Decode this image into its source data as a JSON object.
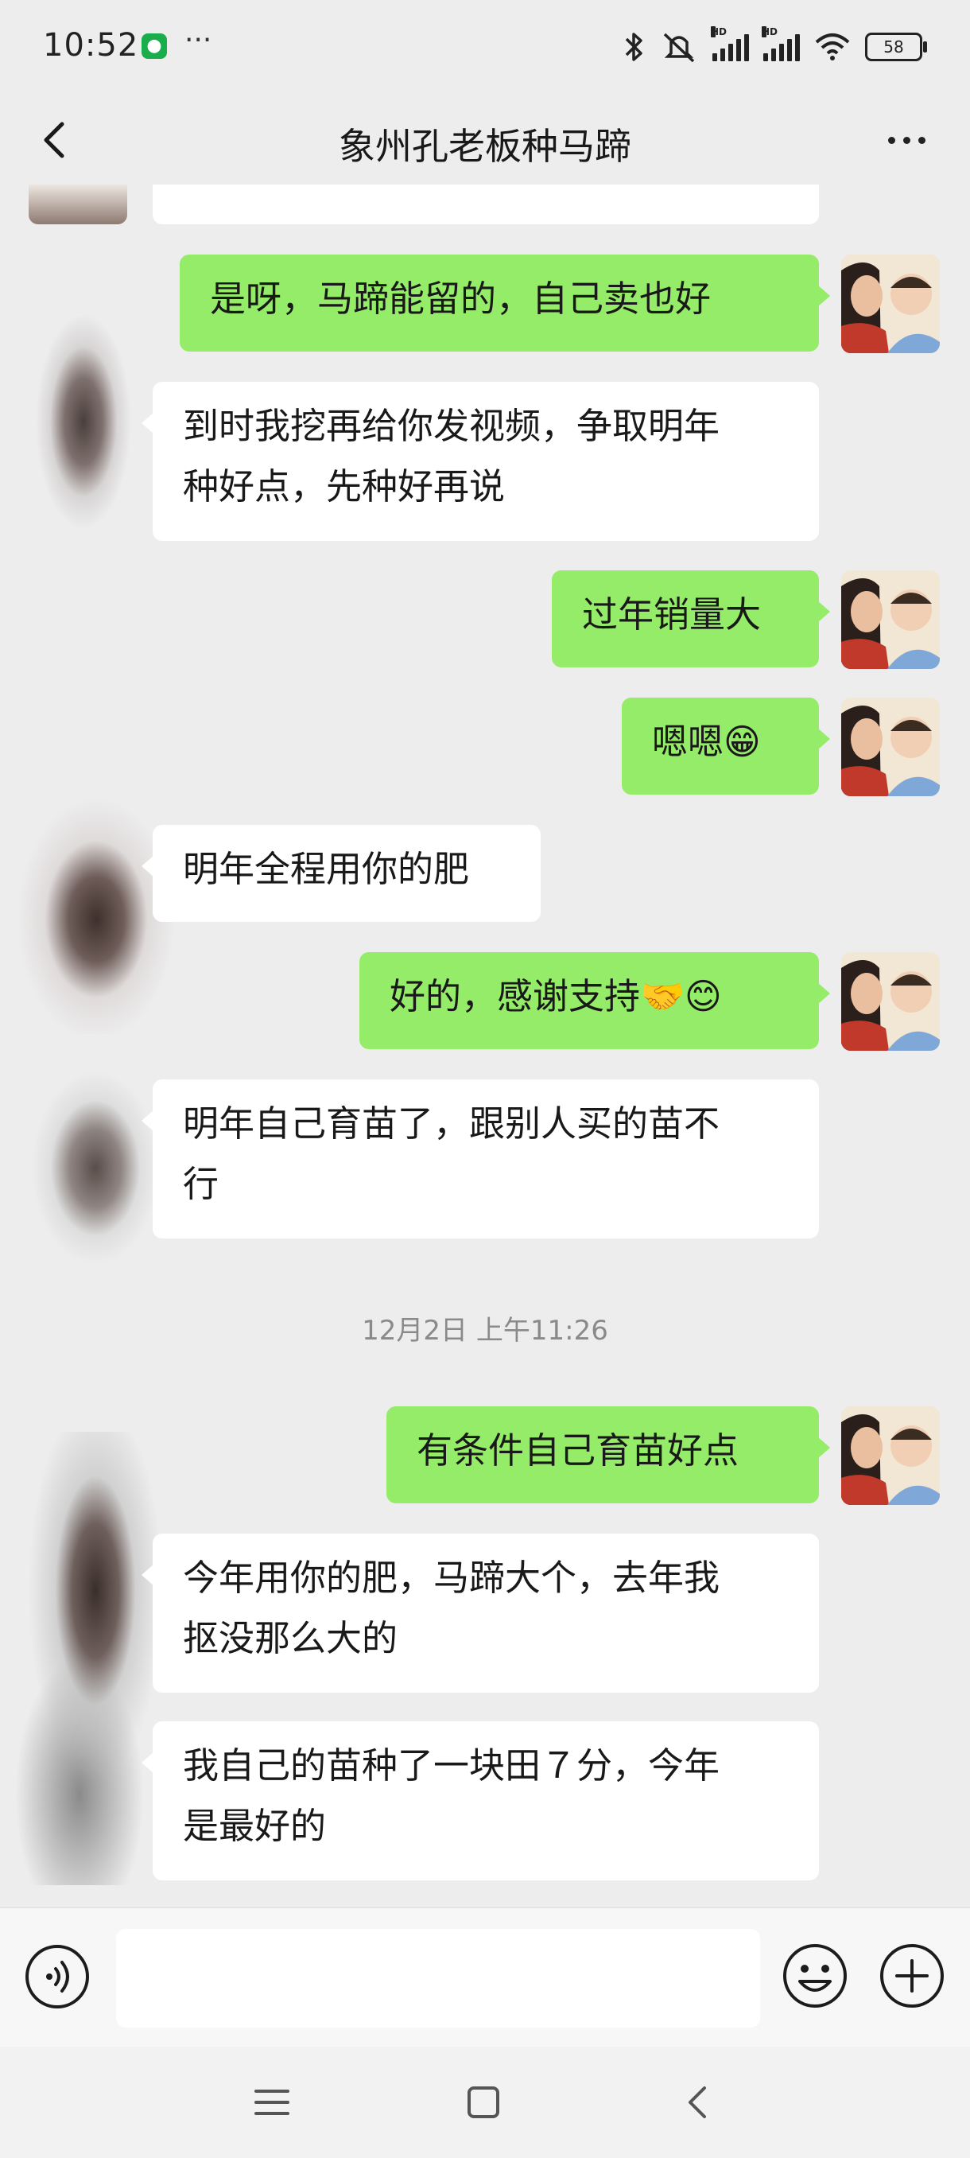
{
  "status_bar": {
    "time": "10:52",
    "more": "···",
    "battery": "58",
    "icons": [
      "bluetooth-icon",
      "mute-icon",
      "signal-hd-icon",
      "signal-hd-icon",
      "wifi-icon",
      "battery-icon"
    ]
  },
  "header": {
    "title": "象州孔老板种马蹄"
  },
  "messages": [
    {
      "from": "me",
      "text": "是呀，马蹄能留的，自己卖也好"
    },
    {
      "from": "other",
      "lines": [
        "到时我挖再给你发视频，争取明年",
        "种好点，先种好再说"
      ]
    },
    {
      "from": "me",
      "text": "过年销量大"
    },
    {
      "from": "me",
      "text": "嗯嗯😁"
    },
    {
      "from": "other",
      "text": "明年全程用你的肥"
    },
    {
      "from": "me",
      "text": "好的，感谢支持🤝😊"
    },
    {
      "from": "other",
      "lines": [
        "明年自己育苗了，跟别人买的苗不",
        "行"
      ]
    },
    {
      "from": "me",
      "text": "有条件自己育苗好点"
    },
    {
      "from": "other",
      "lines": [
        "今年用你的肥，马蹄大个，去年我",
        "抠没那么大的"
      ]
    },
    {
      "from": "other",
      "lines": [
        "我自己的苗种了一块田７分，今年",
        "是最好的"
      ]
    }
  ],
  "timestamp": "12月2日 上午11:26",
  "input": {
    "value": "",
    "placeholder": ""
  },
  "colors": {
    "background": "#ededed",
    "outgoing_bubble": "#95ec69",
    "incoming_bubble": "#ffffff"
  }
}
